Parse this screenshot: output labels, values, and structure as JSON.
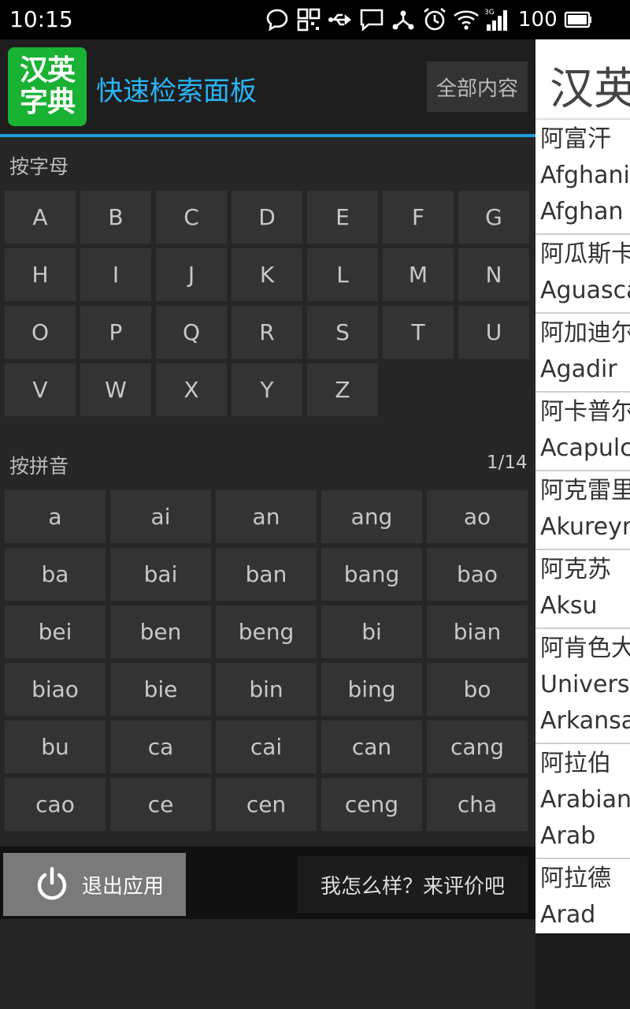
{
  "status": {
    "time": "10:15",
    "battery": "100"
  },
  "header": {
    "logo_line1": "汉英",
    "logo_line2": "字典",
    "title": "快速检索面板",
    "all_button": "全部内容"
  },
  "letters_section": {
    "label": "按字母",
    "letters": [
      "A",
      "B",
      "C",
      "D",
      "E",
      "F",
      "G",
      "H",
      "I",
      "J",
      "K",
      "L",
      "M",
      "N",
      "O",
      "P",
      "Q",
      "R",
      "S",
      "T",
      "U",
      "V",
      "W",
      "X",
      "Y",
      "Z"
    ]
  },
  "pinyin_section": {
    "label": "按拼音",
    "page": "1/14",
    "syllables": [
      "a",
      "ai",
      "an",
      "ang",
      "ao",
      "ba",
      "bai",
      "ban",
      "bang",
      "bao",
      "bei",
      "ben",
      "beng",
      "bi",
      "bian",
      "biao",
      "bie",
      "bin",
      "bing",
      "bo",
      "bu",
      "ca",
      "cai",
      "can",
      "cang",
      "cao",
      "ce",
      "cen",
      "ceng",
      "cha"
    ]
  },
  "bottom": {
    "exit_label": "退出应用",
    "rate_label": "我怎么样？来评价吧"
  },
  "content": {
    "title": "汉英",
    "items": [
      {
        "zh": "阿富汗",
        "en": [
          "Afghanis",
          "Afghan"
        ]
      },
      {
        "zh": "阿瓜斯卡",
        "en": [
          "Aguasca"
        ]
      },
      {
        "zh": "阿加迪尔",
        "en": [
          "Agadir"
        ]
      },
      {
        "zh": "阿卡普尔",
        "en": [
          "Acapulc"
        ]
      },
      {
        "zh": "阿克雷里",
        "en": [
          "Akureyri"
        ]
      },
      {
        "zh": "阿克苏",
        "en": [
          "Aksu"
        ]
      },
      {
        "zh": "阿肯色大",
        "en": [
          "Universi",
          "Arkansa"
        ]
      },
      {
        "zh": "阿拉伯",
        "en": [
          "Arabian;",
          "Arab"
        ]
      },
      {
        "zh": "阿拉德",
        "en": [
          "Arad"
        ]
      }
    ]
  }
}
